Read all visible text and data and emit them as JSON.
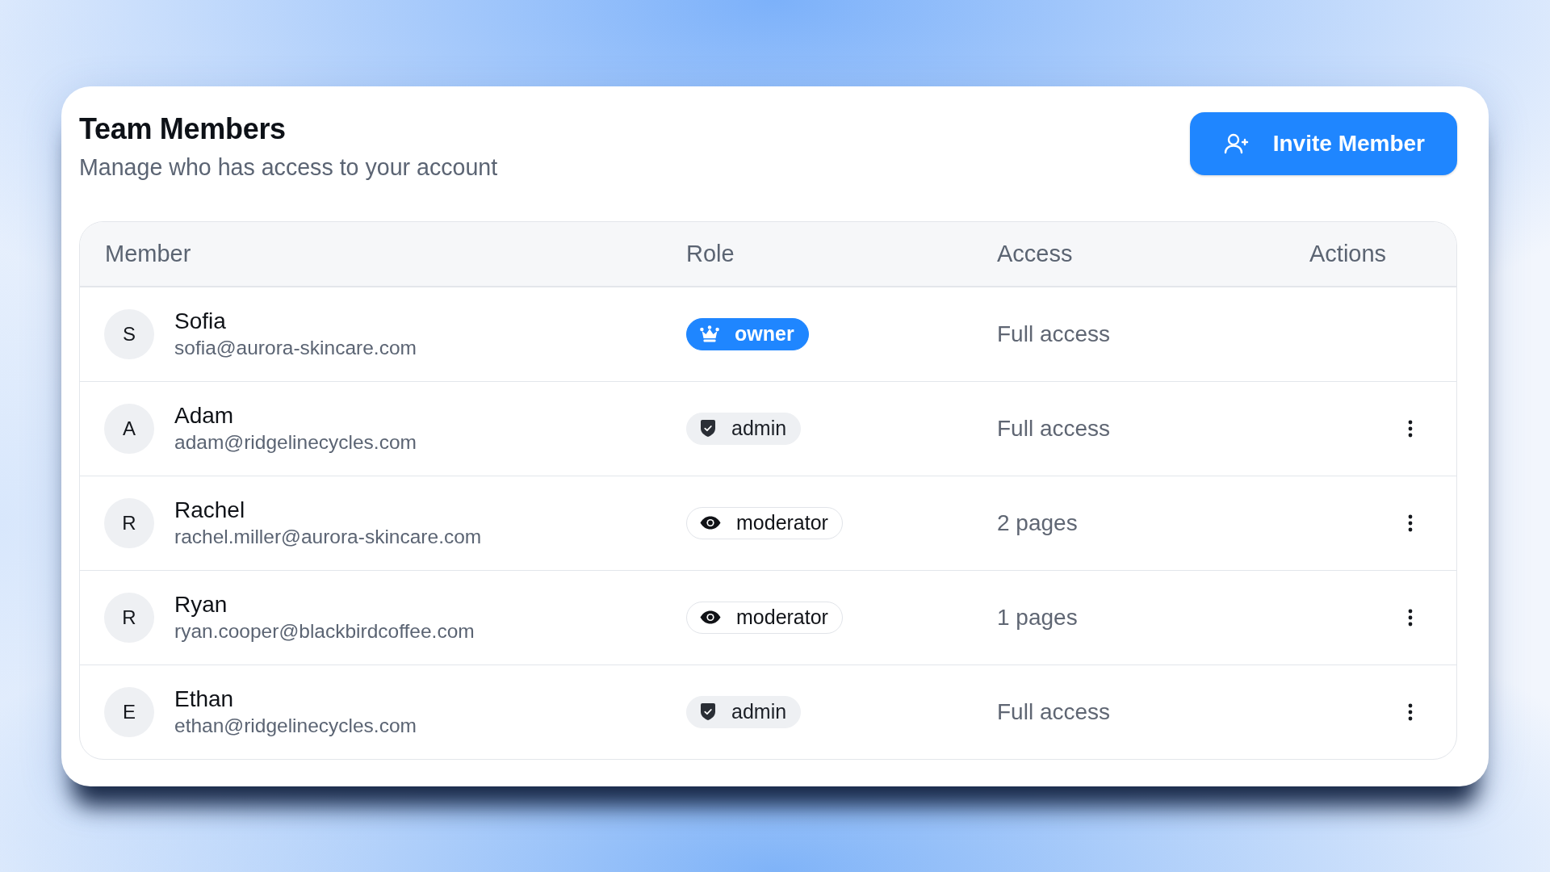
{
  "header": {
    "title": "Team Members",
    "subtitle": "Manage who has access to your account"
  },
  "invite_button": {
    "label": "Invite Member"
  },
  "table": {
    "columns": [
      "Member",
      "Role",
      "Access",
      "Actions"
    ],
    "rows": [
      {
        "initial": "S",
        "name": "Sofia",
        "email": "sofia@aurora-skincare.com",
        "role": {
          "kind": "owner",
          "label": "owner"
        },
        "access": "Full access",
        "actions_menu": false
      },
      {
        "initial": "A",
        "name": "Adam",
        "email": "adam@ridgelinecycles.com",
        "role": {
          "kind": "admin",
          "label": "admin"
        },
        "access": "Full access",
        "actions_menu": true
      },
      {
        "initial": "R",
        "name": "Rachel",
        "email": "rachel.miller@aurora-skincare.com",
        "role": {
          "kind": "moderator",
          "label": "moderator"
        },
        "access": "2 pages",
        "actions_menu": true
      },
      {
        "initial": "R",
        "name": "Ryan",
        "email": "ryan.cooper@blackbirdcoffee.com",
        "role": {
          "kind": "moderator",
          "label": "moderator"
        },
        "access": "1 pages",
        "actions_menu": true
      },
      {
        "initial": "E",
        "name": "Ethan",
        "email": "ethan@ridgelinecycles.com",
        "role": {
          "kind": "admin",
          "label": "admin"
        },
        "access": "Full access",
        "actions_menu": true
      }
    ]
  }
}
